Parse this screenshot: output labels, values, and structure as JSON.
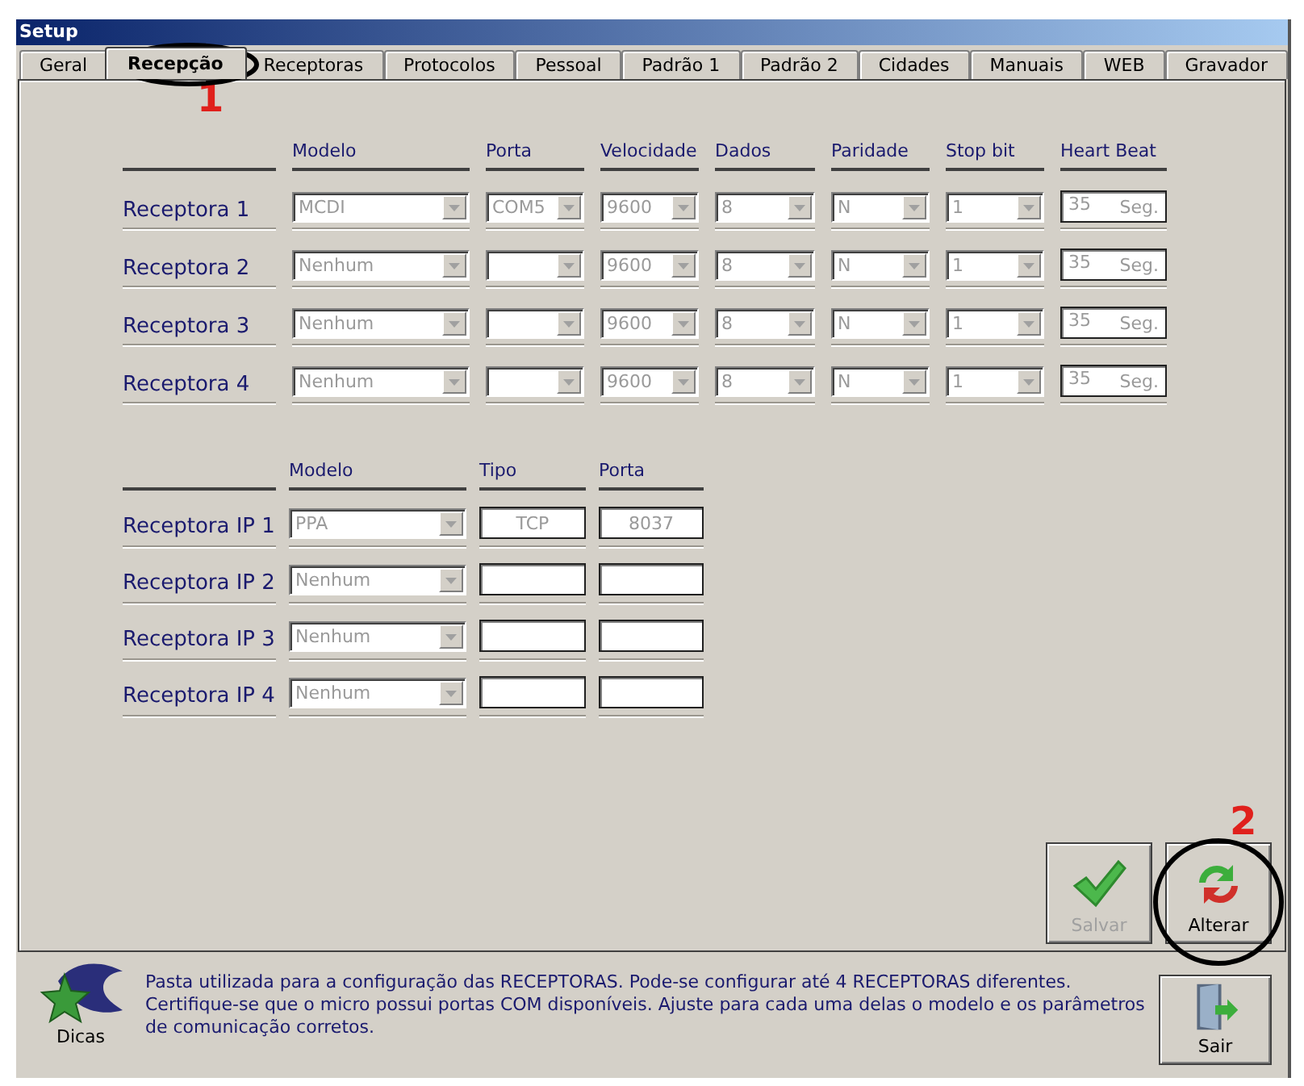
{
  "window": {
    "title": "Setup"
  },
  "tabs": [
    {
      "label": "Geral",
      "selected": false
    },
    {
      "label": "Recepção",
      "selected": true
    },
    {
      "label": "Receptoras",
      "selected": false
    },
    {
      "label": "Protocolos",
      "selected": false
    },
    {
      "label": "Pessoal",
      "selected": false
    },
    {
      "label": "Padrão 1",
      "selected": false
    },
    {
      "label": "Padrão 2",
      "selected": false
    },
    {
      "label": "Cidades",
      "selected": false
    },
    {
      "label": "Manuais",
      "selected": false
    },
    {
      "label": "WEB",
      "selected": false
    },
    {
      "label": "Gravador",
      "selected": false
    }
  ],
  "serial": {
    "columns": [
      "Modelo",
      "Porta",
      "Velocidade",
      "Dados",
      "Paridade",
      "Stop bit",
      "Heart Beat"
    ],
    "rows": [
      {
        "label": "Receptora 1",
        "modelo": "MCDI",
        "porta": "COM5",
        "velocidade": "9600",
        "dados": "8",
        "paridade": "N",
        "stop_bit": "1",
        "heart_beat": "35",
        "heart_beat_unit": "Seg."
      },
      {
        "label": "Receptora 2",
        "modelo": "Nenhum",
        "velocidade": "9600",
        "dados": "8",
        "paridade": "N",
        "stop_bit": "1",
        "heart_beat": "35",
        "heart_beat_unit": "Seg."
      },
      {
        "label": "Receptora 3",
        "modelo": "Nenhum",
        "velocidade": "9600",
        "dados": "8",
        "paridade": "N",
        "stop_bit": "1",
        "heart_beat": "35",
        "heart_beat_unit": "Seg."
      },
      {
        "label": "Receptora 4",
        "modelo": "Nenhum",
        "velocidade": "9600",
        "dados": "8",
        "paridade": "N",
        "stop_bit": "1",
        "heart_beat": "35",
        "heart_beat_unit": "Seg."
      }
    ]
  },
  "ip": {
    "columns": [
      "Modelo",
      "Tipo",
      "Porta"
    ],
    "rows": [
      {
        "label": "Receptora IP 1",
        "modelo": "PPA",
        "tipo": "TCP",
        "porta": "8037"
      },
      {
        "label": "Receptora IP 2",
        "modelo": "Nenhum"
      },
      {
        "label": "Receptora IP 3",
        "modelo": "Nenhum"
      },
      {
        "label": "Receptora IP 4",
        "modelo": "Nenhum"
      }
    ]
  },
  "buttons": [
    {
      "kind": "save",
      "label": "Salvar",
      "disabled": true
    },
    {
      "kind": "change",
      "label": "Alterar",
      "disabled": false
    }
  ],
  "annotations": [
    {
      "kind": "tab",
      "number": "1"
    },
    {
      "kind": "button",
      "number": "2"
    }
  ],
  "hint": {
    "label": "Dicas",
    "lines": [
      "Pasta utilizada para a configuração das RECEPTORAS. Pode-se configurar até 4 RECEPTORAS diferentes.",
      "Certifique-se que o micro possui portas COM disponíveis. Ajuste para cada uma delas o modelo e os parâmetros",
      "de comunicação corretos."
    ]
  },
  "exit_button": {
    "kind": "exit",
    "label": "Sair",
    "disabled": false
  }
}
